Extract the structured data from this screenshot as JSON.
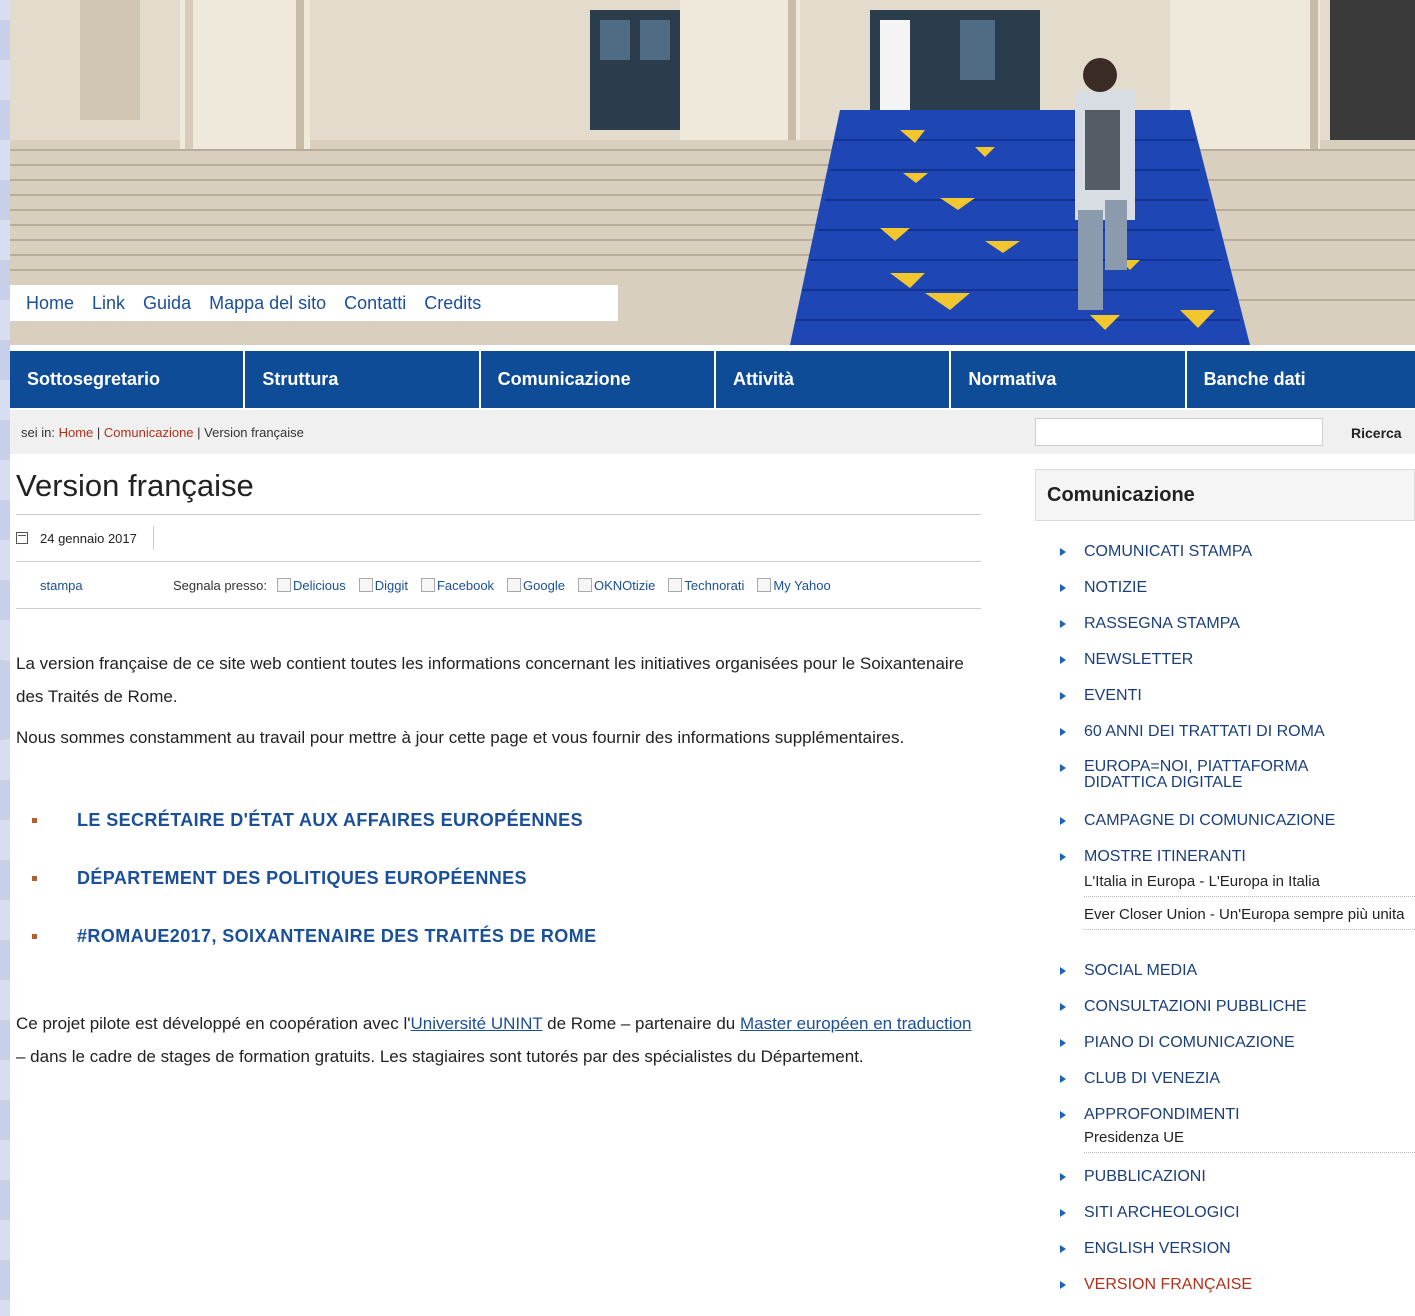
{
  "top_links": [
    "Home",
    "Link",
    "Guida",
    "Mappa del sito",
    "Contatti",
    "Credits"
  ],
  "main_nav": [
    "Sottosegretario",
    "Struttura",
    "Comunicazione",
    "Attività",
    "Normativa",
    "Banche dati"
  ],
  "breadcrumb": {
    "prefix": "sei in:",
    "home": "Home",
    "sep": "|",
    "section": "Comunicazione",
    "current": "Version française"
  },
  "search": {
    "value": "",
    "button": "Ricerca"
  },
  "article": {
    "title": "Version française",
    "date": "24 gennaio 2017",
    "print": "stampa",
    "share_label": "Segnala presso:",
    "share_targets": [
      "Delicious",
      "Diggit",
      "Facebook",
      "Google",
      "OKNOtizie",
      "Technorati",
      "My Yahoo"
    ],
    "para1": "La version française de ce site web contient toutes les informations concernant les initiatives organisées pour le Soixantenaire des Traités de Rome.",
    "para2": "Nous sommes constamment au travail pour mettre à jour cette page et vous fournir des informations supplémentaires.",
    "links": [
      "LE SECRÉTAIRE D'ÉTAT AUX AFFAIRES EUROPÉENNES",
      "DÉPARTEMENT DES POLITIQUES EUROPÉENNES",
      "#ROMAUE2017, SOIXANTENAIRE DES TRAITÉS DE ROME"
    ],
    "para3_a": "Ce projet pilote est développé en coopération avec l'",
    "para3_link1": "Université UNINT",
    "para3_b": " de Rome – partenaire du ",
    "para3_link2": "Master européen en traduction",
    "para3_c": " – dans le cadre de stages de formation gratuits. Les stagiaires sont  tutorés par des spécialistes du Département."
  },
  "sidebar": {
    "title": "Comunicazione",
    "items": [
      "COMUNICATI STAMPA",
      "NOTIZIE",
      "RASSEGNA STAMPA",
      "NEWSLETTER",
      "EVENTI",
      "60 ANNI DEI TRATTATI DI ROMA",
      "EUROPA=NOI, PIATTAFORMA DIDATTICA DIGITALE",
      "CAMPAGNE DI COMUNICAZIONE",
      "MOSTRE ITINERANTI",
      "SOCIAL MEDIA",
      "CONSULTAZIONI PUBBLICHE",
      "PIANO DI COMUNICAZIONE",
      "CLUB DI VENEZIA",
      "APPROFONDIMENTI",
      "PUBBLICAZIONI",
      "SITI ARCHEOLOGICI",
      "ENGLISH VERSION",
      "VERSION FRANÇAISE"
    ],
    "mostre_sub": [
      "L'Italia in Europa - L'Europa in Italia",
      "Ever Closer Union - Un'Europa sempre più unita"
    ],
    "approfondimenti_sub": [
      "Presidenza UE"
    ]
  },
  "colors": {
    "nav_blue": "#0f4c98",
    "link_blue": "#1a4f9a",
    "breadcrumb_red": "#b0301a"
  }
}
